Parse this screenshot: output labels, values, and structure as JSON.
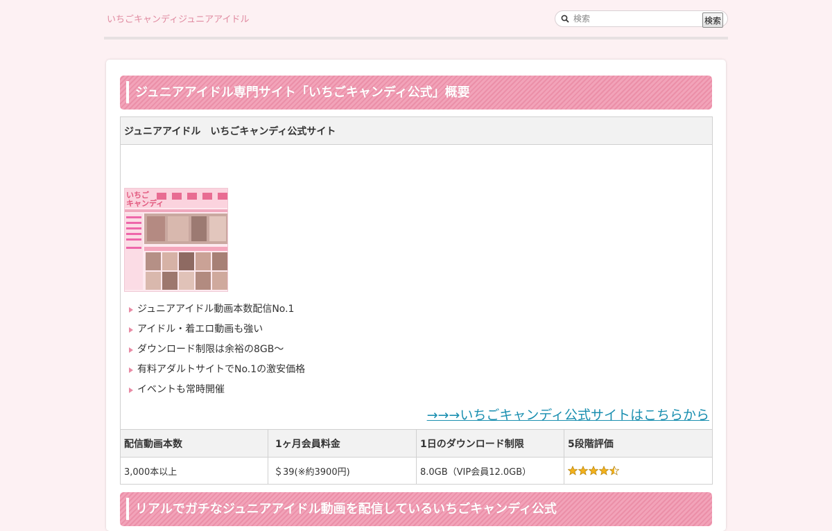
{
  "header": {
    "site_title": "いちごキャンディジュニアアイドル",
    "search_placeholder": "検索",
    "search_button": "検索"
  },
  "section1": {
    "heading": "ジュニアアイドル専門サイト「いちごキャンディ公式」概要",
    "table_caption": "ジュニアアイドル　いちごキャンディ公式サイト",
    "features": [
      "ジュニアアイドル動画本数配信No.1",
      "アイドル・着エロ動画も強い",
      "ダウンロード制限は余裕の8GB〜",
      "有料アダルトサイトでNo.1の激安価格",
      "イベントも常時開催"
    ],
    "cta_link": "→→→いちごキャンディ公式サイトはこちらから",
    "spec_headers": [
      "配信動画本数",
      "1ヶ月会員料金",
      "1日のダウンロード制限",
      "5段階評価"
    ],
    "spec_values": [
      "3,000本以上",
      "＄39(※約3900円)",
      "8.0GB（VIP会員12.0GB）"
    ],
    "rating": 4.5
  },
  "section2": {
    "heading": "リアルでガチなジュニアアイドル動画を配信しているいちごキャンディ公式"
  },
  "colors": {
    "background": "#fdf1f3",
    "heading_pink": "#eb8fa8",
    "link_blue": "#1a8fb0"
  }
}
